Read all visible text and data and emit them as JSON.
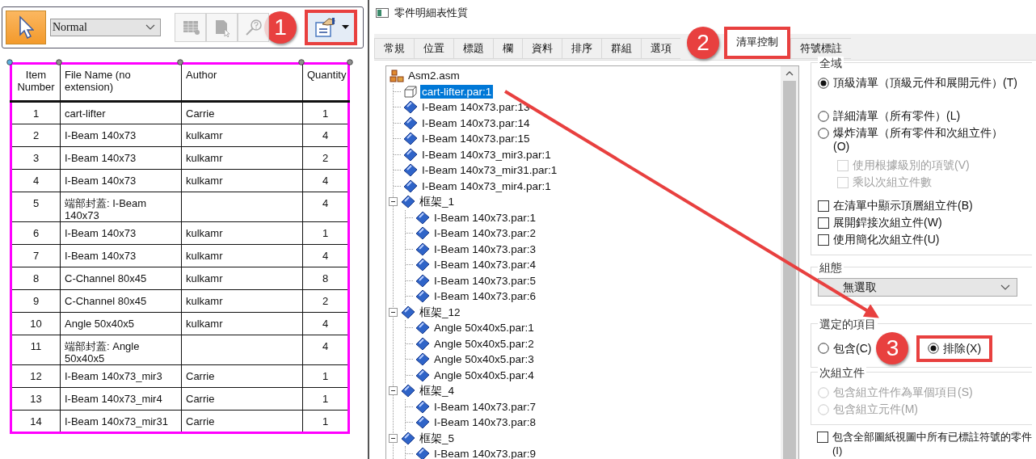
{
  "toolbar": {
    "select_tool": {
      "selected": true
    },
    "style_dropdown": {
      "value": "Normal"
    },
    "tools": [
      {
        "kind": "grid",
        "disabled": true
      },
      {
        "kind": "page",
        "disabled": true
      },
      {
        "kind": "query",
        "disabled": true
      }
    ],
    "properties_button": {
      "highlighted": true,
      "callout": "1"
    }
  },
  "parts_list": {
    "columns": [
      "Item Number",
      "File Name (no extension)",
      "Author",
      "Quantity"
    ],
    "rows": [
      {
        "item": "1",
        "file_name": "cart-lifter",
        "author": "Carrie",
        "quantity": "1"
      },
      {
        "item": "2",
        "file_name": "I-Beam 140x73",
        "author": "kulkamr",
        "quantity": "4"
      },
      {
        "item": "3",
        "file_name": "I-Beam 140x73",
        "author": "kulkamr",
        "quantity": "2"
      },
      {
        "item": "4",
        "file_name": "I-Beam 140x73",
        "author": "kulkamr",
        "quantity": "4"
      },
      {
        "item": "5",
        "file_name": "端部封蓋: I-Beam 140x73",
        "quantity": "4"
      },
      {
        "item": "6",
        "file_name": "I-Beam 140x73",
        "author": "kulkamr",
        "quantity": "1"
      },
      {
        "item": "7",
        "file_name": "I-Beam 140x73",
        "author": "kulkamr",
        "quantity": "4"
      },
      {
        "item": "8",
        "file_name": "C-Channel 80x45",
        "author": "kulkamr",
        "quantity": "8"
      },
      {
        "item": "9",
        "file_name": "C-Channel 80x45",
        "author": "kulkamr",
        "quantity": "2"
      },
      {
        "item": "10",
        "file_name": "Angle 50x40x5",
        "author": "kulkamr",
        "quantity": "4"
      },
      {
        "item": "11",
        "file_name": "端部封蓋: Angle 50x40x5",
        "quantity": "4"
      },
      {
        "item": "12",
        "file_name": "I-Beam 140x73_mir3",
        "author": "Carrie",
        "quantity": "1"
      },
      {
        "item": "13",
        "file_name": "I-Beam 140x73_mir4",
        "author": "Carrie",
        "quantity": "1"
      },
      {
        "item": "14",
        "file_name": "I-Beam 140x73_mir31",
        "author": "Carrie",
        "quantity": "1"
      }
    ]
  },
  "dialog": {
    "title": "零件明細表性質",
    "tabs": [
      {
        "label": "常規",
        "selected": false,
        "highlighted": false
      },
      {
        "label": "位置",
        "selected": false,
        "highlighted": false
      },
      {
        "label": "標題",
        "selected": false,
        "highlighted": false
      },
      {
        "label": "欄",
        "selected": false,
        "highlighted": false
      },
      {
        "label": "資料",
        "selected": false,
        "highlighted": false
      },
      {
        "label": "排序",
        "selected": false,
        "highlighted": false
      },
      {
        "label": "群組",
        "selected": false,
        "highlighted": false
      },
      {
        "label": "選項",
        "selected": false,
        "highlighted": false
      },
      {
        "label": "清單控制",
        "selected": true,
        "highlighted": true,
        "callout": "2"
      },
      {
        "label": "符號標註",
        "selected": false,
        "highlighted": false
      }
    ],
    "tree": {
      "label": "Asm2.asm",
      "kind": "assembly",
      "selected": false,
      "children": [
        {
          "label": "cart-lifter.par:1",
          "kind": "box",
          "selected": true
        },
        {
          "label": "I-Beam 140x73.par:13",
          "kind": "part",
          "selected": false
        },
        {
          "label": "I-Beam 140x73.par:14",
          "kind": "part",
          "selected": false
        },
        {
          "label": "I-Beam 140x73.par:15",
          "kind": "part",
          "selected": false
        },
        {
          "label": "I-Beam 140x73_mir3.par:1",
          "kind": "part",
          "selected": false
        },
        {
          "label": "I-Beam 140x73_mir31.par:1",
          "kind": "part",
          "selected": false
        },
        {
          "label": "I-Beam 140x73_mir4.par:1",
          "kind": "part",
          "selected": false
        },
        {
          "label": "框架_1",
          "kind": "part",
          "selected": false,
          "expanded": true,
          "children": [
            {
              "label": "I-Beam 140x73.par:1",
              "kind": "part",
              "selected": false
            },
            {
              "label": "I-Beam 140x73.par:2",
              "kind": "part",
              "selected": false
            },
            {
              "label": "I-Beam 140x73.par:3",
              "kind": "part",
              "selected": false
            },
            {
              "label": "I-Beam 140x73.par:4",
              "kind": "part",
              "selected": false
            },
            {
              "label": "I-Beam 140x73.par:5",
              "kind": "part",
              "selected": false
            },
            {
              "label": "I-Beam 140x73.par:6",
              "kind": "part",
              "selected": false
            }
          ]
        },
        {
          "label": "框架_12",
          "kind": "part",
          "selected": false,
          "expanded": true,
          "children": [
            {
              "label": "Angle 50x40x5.par:1",
              "kind": "part",
              "selected": false
            },
            {
              "label": "Angle 50x40x5.par:2",
              "kind": "part",
              "selected": false
            },
            {
              "label": "Angle 50x40x5.par:3",
              "kind": "part",
              "selected": false
            },
            {
              "label": "Angle 50x40x5.par:4",
              "kind": "part",
              "selected": false
            }
          ]
        },
        {
          "label": "框架_4",
          "kind": "part",
          "selected": false,
          "expanded": true,
          "children": [
            {
              "label": "I-Beam 140x73.par:7",
              "kind": "part",
              "selected": false
            },
            {
              "label": "I-Beam 140x73.par:8",
              "kind": "part",
              "selected": false
            }
          ]
        },
        {
          "label": "框架_5",
          "kind": "part",
          "selected": false,
          "expanded": true,
          "children": [
            {
              "label": "I-Beam 140x73.par:9",
              "kind": "part",
              "selected": false
            }
          ]
        }
      ]
    },
    "groups": [
      {
        "kind": "list",
        "label": "全域",
        "options": [
          {
            "kind": "radio",
            "label": "頂級清單（頂級元件和展開元件）(T)",
            "selected": true,
            "disabled": false
          },
          {
            "kind": "radio",
            "label": "詳細清單（所有零件）(L)",
            "selected": false,
            "disabled": false
          },
          {
            "kind": "radio",
            "label": "爆炸清單（所有零件和次組立件）(O)",
            "selected": false,
            "disabled": false,
            "children": [
              {
                "kind": "checkbox",
                "label": "使用根據級別的項號(V)",
                "checked": false,
                "disabled": true
              },
              {
                "kind": "checkbox",
                "label": "乘以次組立件數",
                "checked": false,
                "disabled": true
              }
            ]
          },
          {
            "kind": "checkbox",
            "label": "在清單中顯示頂層組立件(B)",
            "checked": false,
            "disabled": false
          },
          {
            "kind": "checkbox",
            "label": "展開銲接次組立件(W)",
            "checked": false,
            "disabled": false
          },
          {
            "kind": "checkbox",
            "label": "使用簡化次組立件(U)",
            "checked": false,
            "disabled": false
          }
        ]
      },
      {
        "kind": "dropdown",
        "label": "組態",
        "value": "無選取"
      },
      {
        "kind": "row",
        "label": "選定的項目",
        "options": [
          {
            "kind": "radio",
            "label": "包含(C)",
            "selected": false,
            "disabled": false,
            "highlighted": false
          },
          {
            "kind": "radio",
            "label": "排除(X)",
            "selected": true,
            "disabled": false,
            "highlighted": true,
            "callout": "3"
          }
        ]
      },
      {
        "kind": "list",
        "label": "次組立件",
        "options": [
          {
            "kind": "radio",
            "label": "包含組立件作為單個項目(S)",
            "selected": false,
            "disabled": true
          },
          {
            "kind": "radio",
            "label": "包含組立元件(M)",
            "selected": false,
            "disabled": true
          }
        ]
      },
      {
        "kind": "plain",
        "options": [
          {
            "kind": "checkbox",
            "label": "包含全部圖紙視圖中所有已標註符號的零件(I)",
            "checked": false,
            "disabled": false
          }
        ]
      }
    ]
  }
}
